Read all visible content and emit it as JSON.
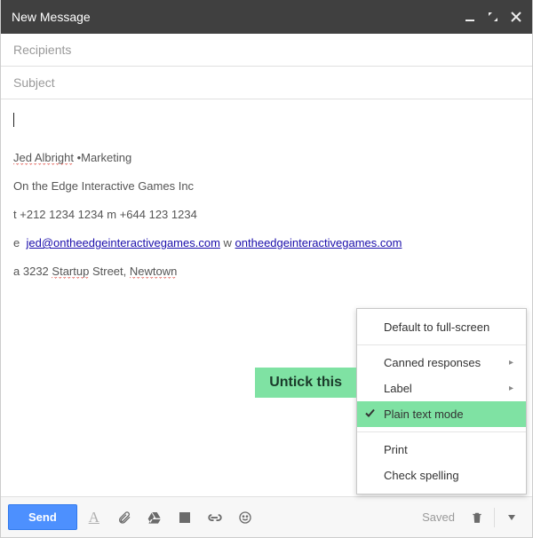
{
  "window": {
    "title": "New Message"
  },
  "fields": {
    "recipients_placeholder": "Recipients",
    "subject_placeholder": "Subject"
  },
  "signature": {
    "name": "Jed Albright",
    "role": "Marketing",
    "company": "On the Edge Interactive Games Inc",
    "tel_label": "t",
    "tel1": "+212 1234 1234",
    "mobile_label": "m",
    "tel2": "+644 123 1234",
    "email_label": "e",
    "email": "jed@ontheedgeinteractivegames.com",
    "web_label": "w",
    "web": "ontheedgeinteractivegames.com",
    "addr_label": "a",
    "address_num": "3232",
    "address_w1": "Startup",
    "address_w2": "Street,",
    "address_w3": "Newtown"
  },
  "toolbar": {
    "send_label": "Send",
    "saved_label": "Saved"
  },
  "menu": {
    "fullscreen": "Default to full-screen",
    "canned": "Canned responses",
    "label": "Label",
    "plaintext": "Plain text mode",
    "print": "Print",
    "spell": "Check spelling"
  },
  "callout": {
    "text": "Untick this"
  }
}
